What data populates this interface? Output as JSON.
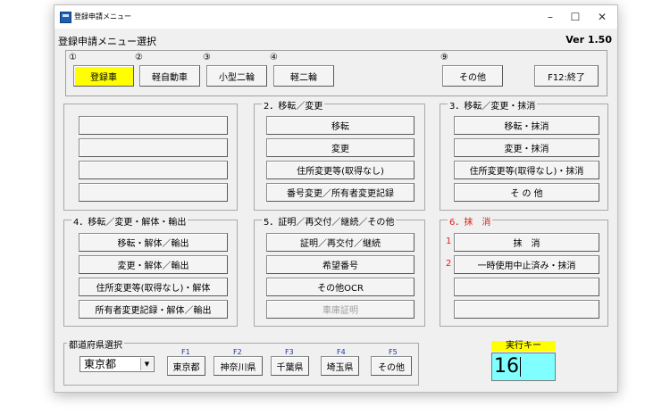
{
  "window": {
    "title": "登録申請メニュー",
    "menu_title": "登録申請メニュー選択",
    "version": "Ver 1.50",
    "controls": [
      "–",
      "☐",
      "✕"
    ]
  },
  "top_buttons": [
    {
      "num": "①",
      "label": "登録車"
    },
    {
      "num": "②",
      "label": "軽自動車"
    },
    {
      "num": "③",
      "label": "小型二輪"
    },
    {
      "num": "④",
      "label": "軽二輪"
    },
    {
      "num": "⑨",
      "label": "その他"
    },
    {
      "num": "",
      "label": "F12:終了"
    }
  ],
  "group1": {
    "title": "",
    "buttons": [
      "",
      "",
      "",
      ""
    ]
  },
  "group2": {
    "title": "2．移転／変更",
    "buttons": [
      "移転",
      "変更",
      "住所変更等(取得なし)",
      "番号変更／所有者変更記録"
    ]
  },
  "group3": {
    "title": "3．移転／変更・抹消",
    "buttons": [
      "移転・抹消",
      "変更・抹消",
      "住所変更等(取得なし)・抹消",
      "そ の 他"
    ]
  },
  "group4": {
    "title": "4．移転／変更・解体・輸出",
    "buttons": [
      "移転・解体／輸出",
      "変更・解体／輸出",
      "住所変更等(取得なし)・解体",
      "所有者変更記録・解体／輸出"
    ]
  },
  "group5": {
    "title": "5．証明／再交付／継続／その他",
    "buttons": [
      "証明／再交付／継続",
      "希望番号",
      "その他OCR",
      "車庫証明"
    ]
  },
  "group6": {
    "title": "6．抹　消",
    "buttons": [
      "抹　消",
      "一時使用中止済み・抹消",
      "",
      ""
    ],
    "nums": [
      "1",
      "2"
    ]
  },
  "prefecture": {
    "title": "都道府県選択",
    "selected": "東京都",
    "fkeys": [
      {
        "key": "F1",
        "label": "東京都"
      },
      {
        "key": "F2",
        "label": "神奈川県"
      },
      {
        "key": "F3",
        "label": "千葉県"
      },
      {
        "key": "F4",
        "label": "埼玉県"
      },
      {
        "key": "F5",
        "label": "その他"
      }
    ]
  },
  "exec": {
    "label": "実行キー",
    "value": "16"
  },
  "colors": {
    "accent_yellow": "#ffff00",
    "exec_input": "#7fffff",
    "red": "#e02020"
  }
}
